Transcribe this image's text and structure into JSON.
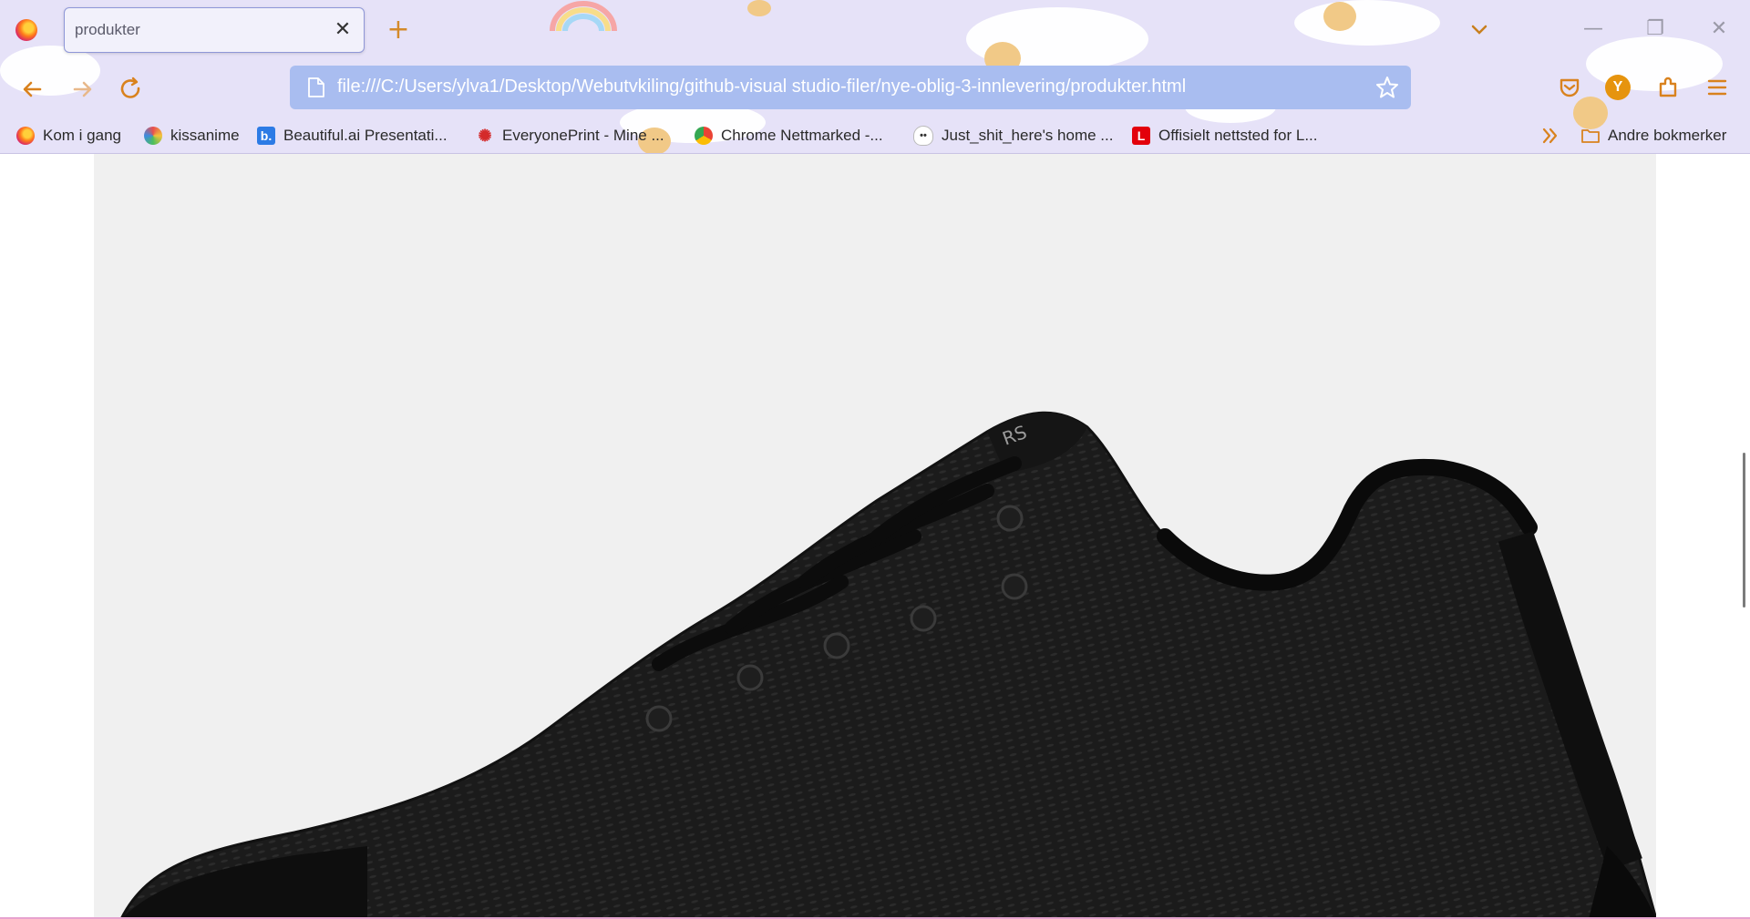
{
  "browser": {
    "tab": {
      "title": "produkter"
    },
    "url": "file:///C:/Users/ylva1/Desktop/Webutvkiling/github-visual studio-filer/nye-oblig-3-innlevering/produkter.html",
    "avatar_letter": "Y",
    "accent_color": "#a9bdf0",
    "theme_color": "#e6e2f8"
  },
  "bookmarks": {
    "items": [
      {
        "label": "Kom i gang",
        "icon": "firefox-icon"
      },
      {
        "label": "kissanime",
        "icon": "kissanime-icon"
      },
      {
        "label": "Beautiful.ai Presentati...",
        "icon": "beautiful-ai-icon",
        "badge": "b."
      },
      {
        "label": "EveryonePrint - Mine ...",
        "icon": "everyoneprint-icon"
      },
      {
        "label": "Chrome Nettmarked -...",
        "icon": "chrome-webstore-icon"
      },
      {
        "label": "Just_shit_here's home ...",
        "icon": "ghost-icon"
      },
      {
        "label": "Offisielt nettsted for L...",
        "icon": "lego-icon",
        "badge": "L"
      }
    ],
    "other_label": "Andre bokmerker"
  },
  "page": {
    "image": "black-sneaker",
    "background": "#f0f0f0"
  }
}
